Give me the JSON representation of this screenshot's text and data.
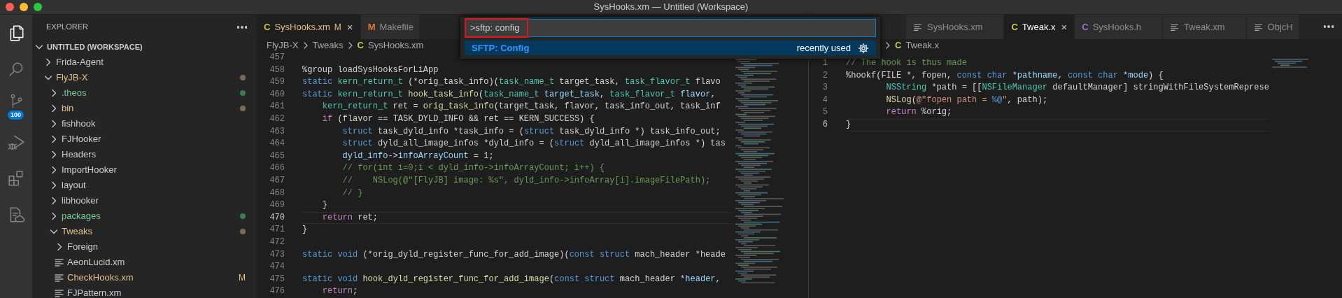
{
  "window": {
    "title": "SysHooks.xm — Untitled (Workspace)"
  },
  "activity_bar": [
    {
      "kind": "explorer",
      "selected": true
    },
    {
      "kind": "search",
      "selected": false
    },
    {
      "kind": "source-control",
      "selected": false,
      "badge": "100"
    },
    {
      "kind": "run-debug",
      "selected": false
    },
    {
      "kind": "extensions",
      "selected": false
    },
    {
      "kind": "remote-explorer",
      "selected": false
    }
  ],
  "sidebar": {
    "title": "EXPLORER",
    "workspace": {
      "label": "UNTITLED (WORKSPACE)",
      "expanded": true,
      "children": [
        {
          "label": "Frida-Agent",
          "kind": "folder",
          "expanded": false,
          "modified": false,
          "untracked": false
        },
        {
          "label": "FlyJB-X",
          "kind": "folder",
          "expanded": true,
          "modified": true,
          "untracked": false,
          "children": [
            {
              "label": ".theos",
              "kind": "folder",
              "expanded": false,
              "modified": false,
              "untracked": true
            },
            {
              "label": "bin",
              "kind": "folder",
              "expanded": false,
              "modified": true,
              "untracked": false
            },
            {
              "label": "fishhook",
              "kind": "folder",
              "expanded": false,
              "modified": false,
              "untracked": false
            },
            {
              "label": "FJHooker",
              "kind": "folder",
              "expanded": false,
              "modified": false,
              "untracked": false
            },
            {
              "label": "Headers",
              "kind": "folder",
              "expanded": false,
              "modified": false,
              "untracked": false
            },
            {
              "label": "ImportHooker",
              "kind": "folder",
              "expanded": false,
              "modified": false,
              "untracked": false
            },
            {
              "label": "layout",
              "kind": "folder",
              "expanded": false,
              "modified": false,
              "untracked": false
            },
            {
              "label": "libhooker",
              "kind": "folder",
              "expanded": false,
              "modified": false,
              "untracked": false
            },
            {
              "label": "packages",
              "kind": "folder",
              "expanded": false,
              "modified": false,
              "untracked": true
            },
            {
              "label": "Tweaks",
              "kind": "folder",
              "expanded": true,
              "modified": true,
              "untracked": false,
              "children": [
                {
                  "label": "Foreign",
                  "kind": "folder",
                  "expanded": false,
                  "modified": false,
                  "untracked": false
                },
                {
                  "label": "AeonLucid.xm",
                  "kind": "file",
                  "modified": false,
                  "untracked": false
                },
                {
                  "label": "CheckHooks.xm",
                  "kind": "file",
                  "modified": true,
                  "untracked": false,
                  "badge": "M"
                },
                {
                  "label": "FJPattern.xm",
                  "kind": "file",
                  "modified": false,
                  "untracked": false
                }
              ]
            }
          ]
        }
      ]
    }
  },
  "editor_groups": [
    {
      "tabs": [
        {
          "label": "SysHooks.xm",
          "kind": "letter",
          "glyph": "C",
          "color": "#cbcb41",
          "selected": true,
          "modified": "M",
          "close": "×"
        },
        {
          "label": "Makefile",
          "kind": "letter",
          "glyph": "M",
          "color": "#e37933",
          "selected": false
        }
      ],
      "breadcrumb": [
        {
          "label": "FlyJB-X",
          "chevron_before": false
        },
        {
          "label": "Tweaks",
          "chevron_before": true
        },
        {
          "label": "SysHooks.xm",
          "glyph": "C",
          "color": "#cbcb41",
          "chevron_before": true
        }
      ],
      "lines": [
        {
          "number": "457",
          "current": false
        },
        {
          "number": "458",
          "current": false,
          "tokens": [
            {
              "kind": "pl",
              "text": "%group loadSysHooksForLiApp"
            }
          ]
        },
        {
          "number": "459",
          "current": false,
          "tokens": [
            {
              "kind": "kw",
              "text": "static "
            },
            {
              "kind": "type",
              "text": "kern_return_t"
            },
            {
              "kind": "pl",
              "text": " (*orig_task_info)("
            },
            {
              "kind": "type",
              "text": "task_name_t"
            },
            {
              "kind": "pl",
              "text": " target_task, "
            },
            {
              "kind": "type",
              "text": "task_flavor_t"
            },
            {
              "kind": "pl",
              "text": " flavo"
            }
          ]
        },
        {
          "number": "460",
          "current": false,
          "tokens": [
            {
              "kind": "kw",
              "text": "static "
            },
            {
              "kind": "type",
              "text": "kern_return_t "
            },
            {
              "kind": "fn",
              "text": "hook_task_info"
            },
            {
              "kind": "pl",
              "text": "("
            },
            {
              "kind": "type",
              "text": "task_name_t "
            },
            {
              "kind": "var",
              "text": "target_task"
            },
            {
              "kind": "pl",
              "text": ", "
            },
            {
              "kind": "type",
              "text": "task_flavor_t "
            },
            {
              "kind": "var",
              "text": "flavor"
            },
            {
              "kind": "pl",
              "text": ","
            }
          ]
        },
        {
          "number": "461",
          "current": false,
          "tokens": [
            {
              "kind": "type",
              "text": "    kern_return_t"
            },
            {
              "kind": "pl",
              "text": " ret = "
            },
            {
              "kind": "fn",
              "text": "orig_task_info"
            },
            {
              "kind": "pl",
              "text": "(target_task, flavor, task_info_out, task_inf"
            }
          ]
        },
        {
          "number": "462",
          "current": false,
          "tokens": [
            {
              "kind": "ctrl",
              "text": "    if"
            },
            {
              "kind": "pl",
              "text": " (flavor == TASK_DYLD_INFO && ret == KERN_SUCCESS) {"
            }
          ]
        },
        {
          "number": "463",
          "current": false,
          "tokens": [
            {
              "kind": "kw",
              "text": "        struct"
            },
            {
              "kind": "pl",
              "text": " task_dyld_info *task_info = ("
            },
            {
              "kind": "kw",
              "text": "struct"
            },
            {
              "kind": "pl",
              "text": " task_dyld_info *) task_info_out;"
            }
          ]
        },
        {
          "number": "464",
          "current": false,
          "tokens": [
            {
              "kind": "kw",
              "text": "        struct"
            },
            {
              "kind": "pl",
              "text": " dyld_all_image_infos *dyld_info = ("
            },
            {
              "kind": "kw",
              "text": "struct"
            },
            {
              "kind": "pl",
              "text": " dyld_all_image_infos *) tas"
            }
          ]
        },
        {
          "number": "465",
          "current": false,
          "tokens": [
            {
              "kind": "var",
              "text": "        dyld_info"
            },
            {
              "kind": "pl",
              "text": "->"
            },
            {
              "kind": "var",
              "text": "infoArrayCount"
            },
            {
              "kind": "pl",
              "text": " = "
            },
            {
              "kind": "num",
              "text": "1"
            },
            {
              "kind": "pl",
              "text": ";"
            }
          ]
        },
        {
          "number": "466",
          "current": false,
          "tokens": [
            {
              "kind": "com",
              "text": "        // for(int i=0;i < dyld_info->infoArrayCount; i++) {"
            }
          ]
        },
        {
          "number": "467",
          "current": false,
          "tokens": [
            {
              "kind": "com",
              "text": "        //    NSLog(@\"[FlyJB] image: %s\", dyld_info->infoArray[i].imageFilePath);"
            }
          ]
        },
        {
          "number": "468",
          "current": false,
          "tokens": [
            {
              "kind": "com",
              "text": "        // }"
            }
          ]
        },
        {
          "number": "469",
          "current": false,
          "tokens": [
            {
              "kind": "pl",
              "text": "    }"
            }
          ]
        },
        {
          "number": "470",
          "current": true,
          "tokens": [
            {
              "kind": "ctrl",
              "text": "    return"
            },
            {
              "kind": "pl",
              "text": " ret;"
            }
          ]
        },
        {
          "number": "471",
          "current": false,
          "tokens": [
            {
              "kind": "pl",
              "text": "}"
            }
          ]
        },
        {
          "number": "472",
          "current": false
        },
        {
          "number": "473",
          "current": false,
          "tokens": [
            {
              "kind": "kw",
              "text": "static void"
            },
            {
              "kind": "pl",
              "text": " (*orig_dyld_register_func_for_add_image)("
            },
            {
              "kind": "kw",
              "text": "const struct"
            },
            {
              "kind": "pl",
              "text": " mach_header *heade"
            }
          ]
        },
        {
          "number": "474",
          "current": false
        },
        {
          "number": "475",
          "current": false,
          "tokens": [
            {
              "kind": "kw",
              "text": "static void "
            },
            {
              "kind": "fn",
              "text": "hook_dyld_register_func_for_add_image"
            },
            {
              "kind": "pl",
              "text": "("
            },
            {
              "kind": "kw",
              "text": "const struct"
            },
            {
              "kind": "pl",
              "text": " mach_header *"
            },
            {
              "kind": "var",
              "text": "header"
            },
            {
              "kind": "pl",
              "text": ","
            }
          ]
        },
        {
          "number": "476",
          "current": false,
          "tokens": [
            {
              "kind": "ctrl",
              "text": "    return"
            },
            {
              "kind": "pl",
              "text": ";"
            }
          ]
        }
      ]
    },
    {
      "tabs": [
        {
          "label": "SysHooks.xm",
          "kind": "lines",
          "selected": false
        },
        {
          "label": "Tweak.x",
          "kind": "letter",
          "glyph": "C",
          "color": "#cbcb41",
          "selected": true,
          "close": "×"
        },
        {
          "label": "SysHooks.h",
          "kind": "letter",
          "glyph": "C",
          "color": "#a074c4",
          "selected": false
        },
        {
          "label": "Tweak.xm",
          "kind": "lines",
          "selected": false
        },
        {
          "label": "ObjcH",
          "kind": "lines",
          "selected": false
        }
      ],
      "breadcrumb": [
        {
          "label": "Tweak.x",
          "glyph": "C",
          "color": "#cbcb41",
          "chevron_before": true
        }
      ],
      "lines": [
        {
          "number": "1",
          "current": false,
          "tokens": [
            {
              "kind": "com",
              "text": "// The hook is thus made"
            }
          ]
        },
        {
          "number": "2",
          "current": false,
          "tokens": [
            {
              "kind": "pl",
              "text": "%hookf(FILE *, fopen, "
            },
            {
              "kind": "kw",
              "text": "const char"
            },
            {
              "kind": "pl",
              "text": " *"
            },
            {
              "kind": "var",
              "text": "pathname"
            },
            {
              "kind": "pl",
              "text": ", "
            },
            {
              "kind": "kw",
              "text": "const char"
            },
            {
              "kind": "pl",
              "text": " *"
            },
            {
              "kind": "var",
              "text": "mode"
            },
            {
              "kind": "pl",
              "text": ") {"
            }
          ]
        },
        {
          "number": "3",
          "current": false,
          "tokens": [
            {
              "kind": "type",
              "text": "        NSString"
            },
            {
              "kind": "pl",
              "text": " *path = [["
            },
            {
              "kind": "type",
              "text": "NSFileManager"
            },
            {
              "kind": "pl",
              "text": " defaultManager] stringWithFileSystemReprese"
            }
          ]
        },
        {
          "number": "4",
          "current": false,
          "tokens": [
            {
              "kind": "fn",
              "text": "        NSLog"
            },
            {
              "kind": "pl",
              "text": "("
            },
            {
              "kind": "str",
              "text": "@\"fopen path = "
            },
            {
              "kind": "kw",
              "text": "%@"
            },
            {
              "kind": "str",
              "text": "\""
            },
            {
              "kind": "pl",
              "text": ", path);"
            }
          ]
        },
        {
          "number": "5",
          "current": false,
          "tokens": [
            {
              "kind": "ctrl",
              "text": "        return"
            },
            {
              "kind": "pl",
              "text": " %orig;"
            }
          ]
        },
        {
          "number": "6",
          "current": true,
          "tokens": [
            {
              "kind": "pl",
              "text": "}"
            }
          ]
        }
      ]
    }
  ],
  "command_palette": {
    "input": {
      "value": ">sftp: config",
      "highlighted": true
    },
    "items": [
      {
        "label": "SFTP: Config",
        "detail": "recently used",
        "selected": true
      }
    ]
  }
}
